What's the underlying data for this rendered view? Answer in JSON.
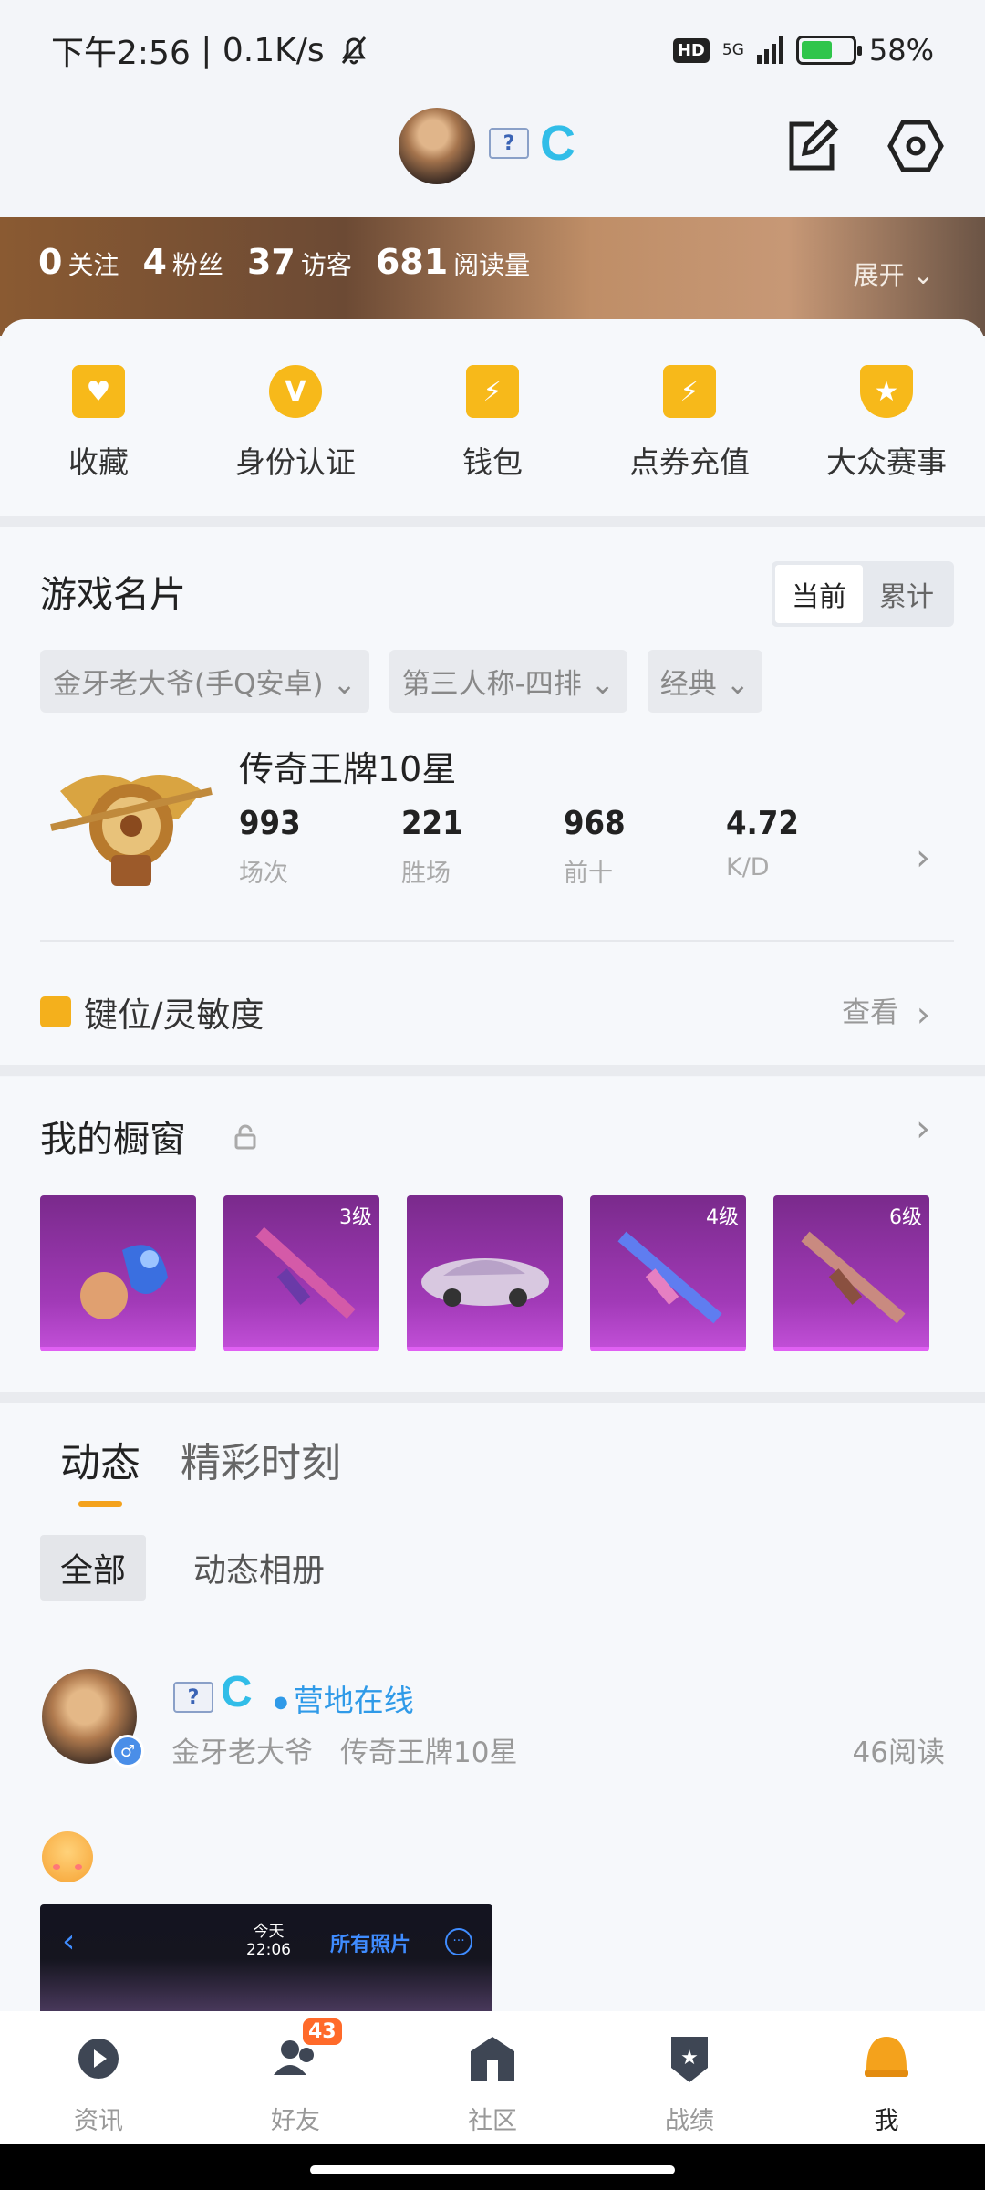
{
  "status": {
    "time": "下午2:56",
    "net_speed": "0.1K/s",
    "hd": "HD",
    "network": "5G",
    "battery": "58%"
  },
  "header": {
    "flag_label": "?",
    "c_badge": "C"
  },
  "stats": [
    {
      "value": "0",
      "label": "关注"
    },
    {
      "value": "4",
      "label": "粉丝"
    },
    {
      "value": "37",
      "label": "访客"
    },
    {
      "value": "681",
      "label": "阅读量"
    }
  ],
  "expand_label": "展开",
  "quick": [
    {
      "label": "收藏",
      "icon": "favorite-icon"
    },
    {
      "label": "身份认证",
      "icon": "verify-icon"
    },
    {
      "label": "钱包",
      "icon": "wallet-icon"
    },
    {
      "label": "点券充值",
      "icon": "recharge-icon"
    },
    {
      "label": "大众赛事",
      "icon": "trophy-icon"
    }
  ],
  "game_card": {
    "title": "游戏名片",
    "seg": [
      "当前",
      "累计"
    ],
    "filters": [
      "金牙老大爷(手Q安卓)",
      "第三人称-四排",
      "经典"
    ],
    "rank": "传奇王牌10星",
    "nums": [
      {
        "value": "993",
        "label": "场次"
      },
      {
        "value": "221",
        "label": "胜场"
      },
      {
        "value": "968",
        "label": "前十"
      },
      {
        "value": "4.72",
        "label": "K/D"
      }
    ],
    "keys_label": "键位/灵敏度",
    "view_label": "查看"
  },
  "showcase": {
    "title": "我的橱窗",
    "items": [
      {
        "level": ""
      },
      {
        "level": "3级"
      },
      {
        "level": ""
      },
      {
        "level": "4级"
      },
      {
        "level": "6级"
      }
    ]
  },
  "feed": {
    "tabs": [
      "动态",
      "精彩时刻"
    ],
    "subtabs": [
      "全部",
      "动态相册"
    ],
    "post": {
      "online": "营地在线",
      "name": "金牙老大爷",
      "rank": "传奇王牌10星",
      "reads": "46阅读",
      "shot_today": "今天",
      "shot_time": "22:06",
      "shot_all": "所有照片"
    }
  },
  "nav": [
    {
      "label": "资讯",
      "icon": "news-icon"
    },
    {
      "label": "好友",
      "icon": "friends-icon",
      "badge": "43"
    },
    {
      "label": "社区",
      "icon": "community-icon"
    },
    {
      "label": "战绩",
      "icon": "record-icon"
    },
    {
      "label": "我",
      "icon": "me-icon",
      "active": true
    }
  ],
  "colors": {
    "accent": "#f4a21c",
    "link": "#2f9ae8",
    "showcase": "#a13ab7"
  }
}
